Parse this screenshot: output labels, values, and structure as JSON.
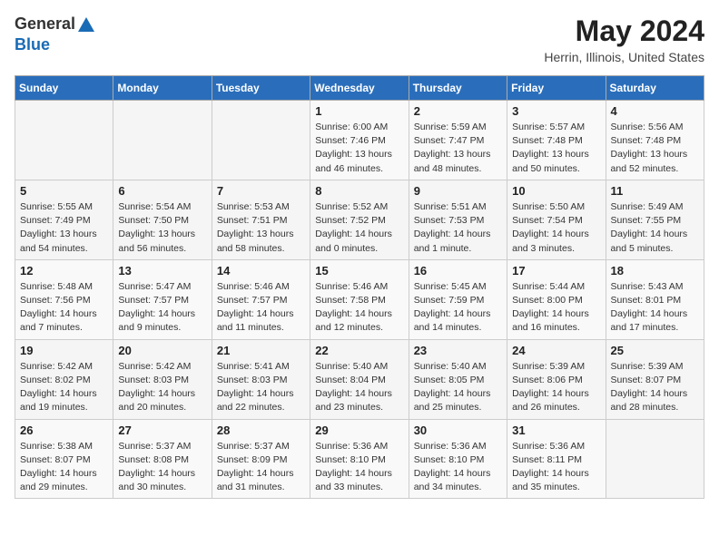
{
  "header": {
    "logo_general": "General",
    "logo_blue": "Blue",
    "month_year": "May 2024",
    "location": "Herrin, Illinois, United States"
  },
  "days_of_week": [
    "Sunday",
    "Monday",
    "Tuesday",
    "Wednesday",
    "Thursday",
    "Friday",
    "Saturday"
  ],
  "weeks": [
    [
      {
        "day": "",
        "info": ""
      },
      {
        "day": "",
        "info": ""
      },
      {
        "day": "",
        "info": ""
      },
      {
        "day": "1",
        "info": "Sunrise: 6:00 AM\nSunset: 7:46 PM\nDaylight: 13 hours\nand 46 minutes."
      },
      {
        "day": "2",
        "info": "Sunrise: 5:59 AM\nSunset: 7:47 PM\nDaylight: 13 hours\nand 48 minutes."
      },
      {
        "day": "3",
        "info": "Sunrise: 5:57 AM\nSunset: 7:48 PM\nDaylight: 13 hours\nand 50 minutes."
      },
      {
        "day": "4",
        "info": "Sunrise: 5:56 AM\nSunset: 7:48 PM\nDaylight: 13 hours\nand 52 minutes."
      }
    ],
    [
      {
        "day": "5",
        "info": "Sunrise: 5:55 AM\nSunset: 7:49 PM\nDaylight: 13 hours\nand 54 minutes."
      },
      {
        "day": "6",
        "info": "Sunrise: 5:54 AM\nSunset: 7:50 PM\nDaylight: 13 hours\nand 56 minutes."
      },
      {
        "day": "7",
        "info": "Sunrise: 5:53 AM\nSunset: 7:51 PM\nDaylight: 13 hours\nand 58 minutes."
      },
      {
        "day": "8",
        "info": "Sunrise: 5:52 AM\nSunset: 7:52 PM\nDaylight: 14 hours\nand 0 minutes."
      },
      {
        "day": "9",
        "info": "Sunrise: 5:51 AM\nSunset: 7:53 PM\nDaylight: 14 hours\nand 1 minute."
      },
      {
        "day": "10",
        "info": "Sunrise: 5:50 AM\nSunset: 7:54 PM\nDaylight: 14 hours\nand 3 minutes."
      },
      {
        "day": "11",
        "info": "Sunrise: 5:49 AM\nSunset: 7:55 PM\nDaylight: 14 hours\nand 5 minutes."
      }
    ],
    [
      {
        "day": "12",
        "info": "Sunrise: 5:48 AM\nSunset: 7:56 PM\nDaylight: 14 hours\nand 7 minutes."
      },
      {
        "day": "13",
        "info": "Sunrise: 5:47 AM\nSunset: 7:57 PM\nDaylight: 14 hours\nand 9 minutes."
      },
      {
        "day": "14",
        "info": "Sunrise: 5:46 AM\nSunset: 7:57 PM\nDaylight: 14 hours\nand 11 minutes."
      },
      {
        "day": "15",
        "info": "Sunrise: 5:46 AM\nSunset: 7:58 PM\nDaylight: 14 hours\nand 12 minutes."
      },
      {
        "day": "16",
        "info": "Sunrise: 5:45 AM\nSunset: 7:59 PM\nDaylight: 14 hours\nand 14 minutes."
      },
      {
        "day": "17",
        "info": "Sunrise: 5:44 AM\nSunset: 8:00 PM\nDaylight: 14 hours\nand 16 minutes."
      },
      {
        "day": "18",
        "info": "Sunrise: 5:43 AM\nSunset: 8:01 PM\nDaylight: 14 hours\nand 17 minutes."
      }
    ],
    [
      {
        "day": "19",
        "info": "Sunrise: 5:42 AM\nSunset: 8:02 PM\nDaylight: 14 hours\nand 19 minutes."
      },
      {
        "day": "20",
        "info": "Sunrise: 5:42 AM\nSunset: 8:03 PM\nDaylight: 14 hours\nand 20 minutes."
      },
      {
        "day": "21",
        "info": "Sunrise: 5:41 AM\nSunset: 8:03 PM\nDaylight: 14 hours\nand 22 minutes."
      },
      {
        "day": "22",
        "info": "Sunrise: 5:40 AM\nSunset: 8:04 PM\nDaylight: 14 hours\nand 23 minutes."
      },
      {
        "day": "23",
        "info": "Sunrise: 5:40 AM\nSunset: 8:05 PM\nDaylight: 14 hours\nand 25 minutes."
      },
      {
        "day": "24",
        "info": "Sunrise: 5:39 AM\nSunset: 8:06 PM\nDaylight: 14 hours\nand 26 minutes."
      },
      {
        "day": "25",
        "info": "Sunrise: 5:39 AM\nSunset: 8:07 PM\nDaylight: 14 hours\nand 28 minutes."
      }
    ],
    [
      {
        "day": "26",
        "info": "Sunrise: 5:38 AM\nSunset: 8:07 PM\nDaylight: 14 hours\nand 29 minutes."
      },
      {
        "day": "27",
        "info": "Sunrise: 5:37 AM\nSunset: 8:08 PM\nDaylight: 14 hours\nand 30 minutes."
      },
      {
        "day": "28",
        "info": "Sunrise: 5:37 AM\nSunset: 8:09 PM\nDaylight: 14 hours\nand 31 minutes."
      },
      {
        "day": "29",
        "info": "Sunrise: 5:36 AM\nSunset: 8:10 PM\nDaylight: 14 hours\nand 33 minutes."
      },
      {
        "day": "30",
        "info": "Sunrise: 5:36 AM\nSunset: 8:10 PM\nDaylight: 14 hours\nand 34 minutes."
      },
      {
        "day": "31",
        "info": "Sunrise: 5:36 AM\nSunset: 8:11 PM\nDaylight: 14 hours\nand 35 minutes."
      },
      {
        "day": "",
        "info": ""
      }
    ]
  ]
}
